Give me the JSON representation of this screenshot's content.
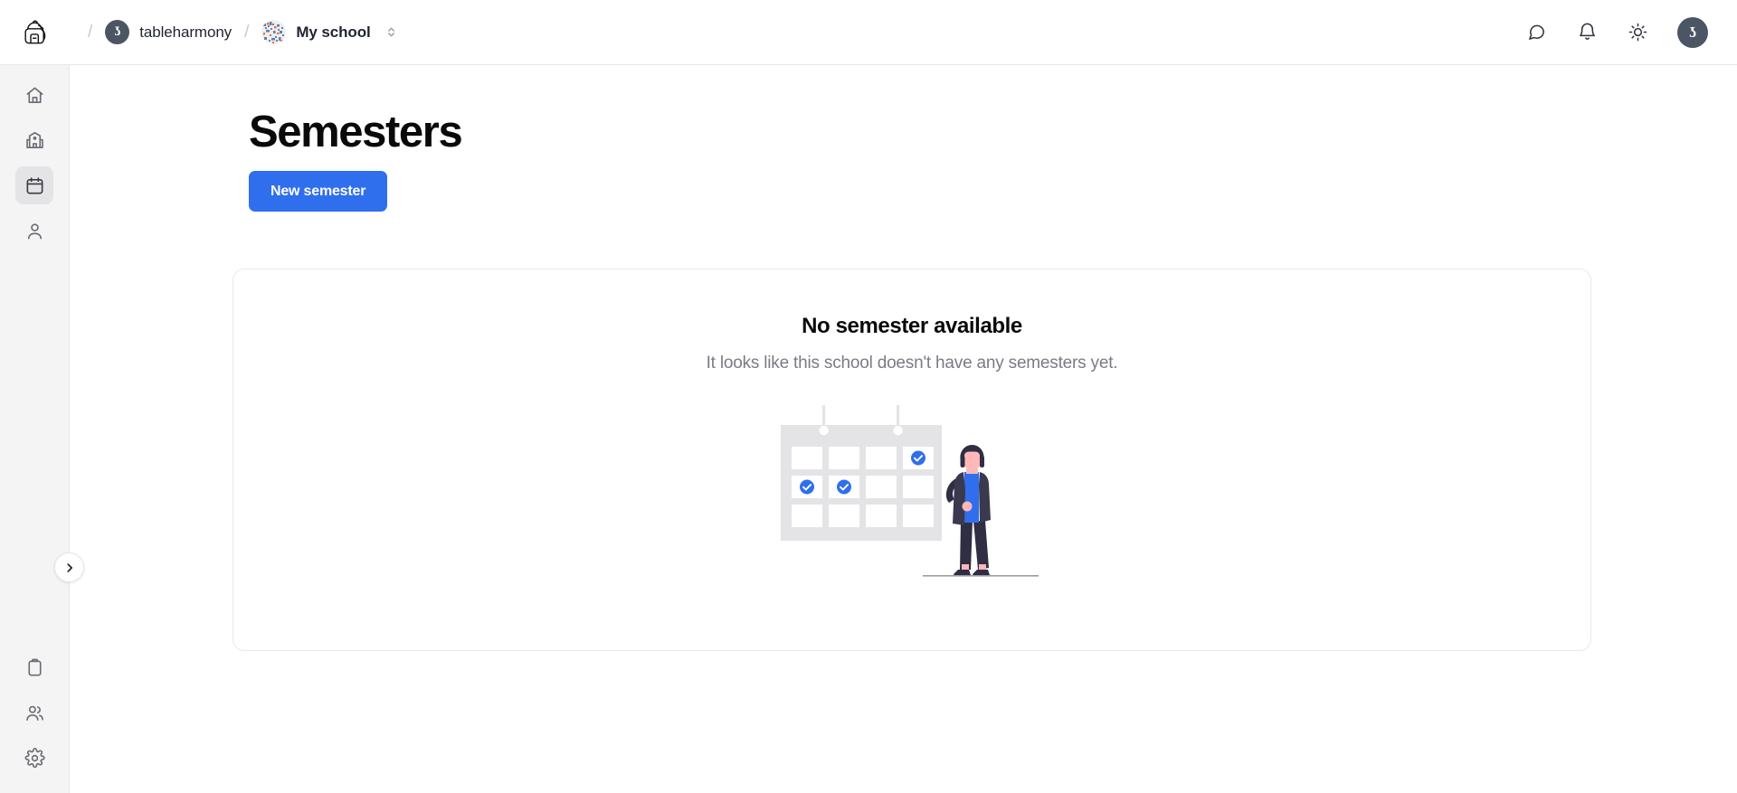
{
  "header": {
    "logo_icon": "backpack-logo",
    "breadcrumb": [
      {
        "label": "tableharmony",
        "avatar_text": "ʖ",
        "avatar_type": "org-monogram"
      },
      {
        "label": "My school",
        "avatar_type": "identicon",
        "bold": true
      }
    ],
    "separator": "/",
    "school_switcher_icon": "chevron-up-down-icon",
    "actions": [
      {
        "icon": "chat-bubble-icon",
        "name": "messages-button"
      },
      {
        "icon": "bell-icon",
        "name": "notifications-button"
      },
      {
        "icon": "sun-icon",
        "name": "theme-toggle-button"
      }
    ],
    "user_avatar_text": "ʖ"
  },
  "sidebar": {
    "top_items": [
      {
        "icon": "home-icon",
        "name": "sidebar-item-home",
        "active": false
      },
      {
        "icon": "school-icon",
        "name": "sidebar-item-school",
        "active": false
      },
      {
        "icon": "calendar-icon",
        "name": "sidebar-item-semesters",
        "active": true
      },
      {
        "icon": "user-icon",
        "name": "sidebar-item-profile",
        "active": false
      }
    ],
    "bottom_items": [
      {
        "icon": "clipboard-icon",
        "name": "sidebar-item-assignments",
        "active": false
      },
      {
        "icon": "users-icon",
        "name": "sidebar-item-members",
        "active": false
      },
      {
        "icon": "gear-icon",
        "name": "sidebar-item-settings",
        "active": false
      }
    ],
    "collapse_icon": "chevron-right-icon"
  },
  "main": {
    "title": "Semesters",
    "new_semester_label": "New semester",
    "empty_state": {
      "title": "No semester available",
      "description": "It looks like this school doesn't have any semesters yet.",
      "illustration": "calendar-with-person"
    }
  },
  "colors": {
    "accent_blue": "#2f6fed",
    "sidebar_bg": "#f4f4f5",
    "border": "#e8e8ea",
    "text_primary": "#0a0a0b",
    "text_muted": "#7b7b85",
    "illustration_gray": "#e4e4e6",
    "figure_dark": "#2f2e43",
    "figure_skin": "#ffb8b8"
  }
}
